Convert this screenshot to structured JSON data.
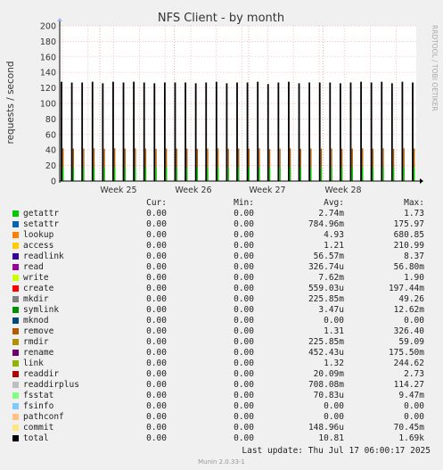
{
  "chart_data": {
    "type": "bar",
    "title": "NFS Client - by month",
    "ylabel": "requests / second",
    "side_label": "RRDTOOL / TOBI OETIKER",
    "ylim": [
      0,
      200
    ],
    "yticks": [
      0,
      20,
      40,
      60,
      80,
      100,
      120,
      140,
      160,
      180,
      200
    ],
    "xticks": [
      "Week 25",
      "Week 26",
      "Week 27",
      "Week 28"
    ],
    "grid": true,
    "series_spikes": {
      "name": "total",
      "values": [
        128,
        127,
        127,
        128,
        126,
        128,
        127,
        128,
        127,
        126,
        127,
        127,
        127,
        126,
        127,
        128,
        126,
        127,
        127,
        128,
        125,
        127,
        128,
        126,
        127,
        127,
        127,
        126,
        127,
        128,
        127,
        128,
        126,
        128,
        127
      ]
    },
    "legend_headers": [
      "Cur:",
      "Min:",
      "Avg:",
      "Max:"
    ],
    "legend": [
      {
        "name": "getattr",
        "color": "#00cc00",
        "cur": "0.00",
        "min": "0.00",
        "avg": "2.74m",
        "max": "1.73"
      },
      {
        "name": "setattr",
        "color": "#0066b3",
        "cur": "0.00",
        "min": "0.00",
        "avg": "784.96m",
        "max": "175.97"
      },
      {
        "name": "lookup",
        "color": "#ff8000",
        "cur": "0.00",
        "min": "0.00",
        "avg": "4.93",
        "max": "680.85"
      },
      {
        "name": "access",
        "color": "#ffcc00",
        "cur": "0.00",
        "min": "0.00",
        "avg": "1.21",
        "max": "210.99"
      },
      {
        "name": "readlink",
        "color": "#330099",
        "cur": "0.00",
        "min": "0.00",
        "avg": "56.57m",
        "max": "8.37"
      },
      {
        "name": "read",
        "color": "#990099",
        "cur": "0.00",
        "min": "0.00",
        "avg": "326.74u",
        "max": "56.80m"
      },
      {
        "name": "write",
        "color": "#ccff00",
        "cur": "0.00",
        "min": "0.00",
        "avg": "7.62m",
        "max": "1.90"
      },
      {
        "name": "create",
        "color": "#ff0000",
        "cur": "0.00",
        "min": "0.00",
        "avg": "559.03u",
        "max": "197.44m"
      },
      {
        "name": "mkdir",
        "color": "#808080",
        "cur": "0.00",
        "min": "0.00",
        "avg": "225.85m",
        "max": "49.26"
      },
      {
        "name": "symlink",
        "color": "#008f00",
        "cur": "0.00",
        "min": "0.00",
        "avg": "3.47u",
        "max": "12.62m"
      },
      {
        "name": "mknod",
        "color": "#00487d",
        "cur": "0.00",
        "min": "0.00",
        "avg": "0.00",
        "max": "0.00"
      },
      {
        "name": "remove",
        "color": "#b35a00",
        "cur": "0.00",
        "min": "0.00",
        "avg": "1.31",
        "max": "326.40"
      },
      {
        "name": "rmdir",
        "color": "#b38f00",
        "cur": "0.00",
        "min": "0.00",
        "avg": "225.85m",
        "max": "59.09"
      },
      {
        "name": "rename",
        "color": "#6b006b",
        "cur": "0.00",
        "min": "0.00",
        "avg": "452.43u",
        "max": "175.50m"
      },
      {
        "name": "link",
        "color": "#8fb300",
        "cur": "0.00",
        "min": "0.00",
        "avg": "1.32",
        "max": "244.62"
      },
      {
        "name": "readdir",
        "color": "#b30000",
        "cur": "0.00",
        "min": "0.00",
        "avg": "20.09m",
        "max": "2.73"
      },
      {
        "name": "readdirplus",
        "color": "#bebebe",
        "cur": "0.00",
        "min": "0.00",
        "avg": "708.08m",
        "max": "114.27"
      },
      {
        "name": "fsstat",
        "color": "#80ff80",
        "cur": "0.00",
        "min": "0.00",
        "avg": "70.83u",
        "max": "9.47m"
      },
      {
        "name": "fsinfo",
        "color": "#80c9ff",
        "cur": "0.00",
        "min": "0.00",
        "avg": "0.00",
        "max": "0.00"
      },
      {
        "name": "pathconf",
        "color": "#ffc080",
        "cur": "0.00",
        "min": "0.00",
        "avg": "0.00",
        "max": "0.00"
      },
      {
        "name": "commit",
        "color": "#ffe680",
        "cur": "0.00",
        "min": "0.00",
        "avg": "148.96u",
        "max": "70.45m"
      },
      {
        "name": "total",
        "color": "#000000",
        "cur": "0.00",
        "min": "0.00",
        "avg": "10.81",
        "max": "1.69k"
      }
    ],
    "last_update": "Last update: Thu Jul 17 06:00:17 2025",
    "credit": "Munin 2.0.33-1"
  }
}
